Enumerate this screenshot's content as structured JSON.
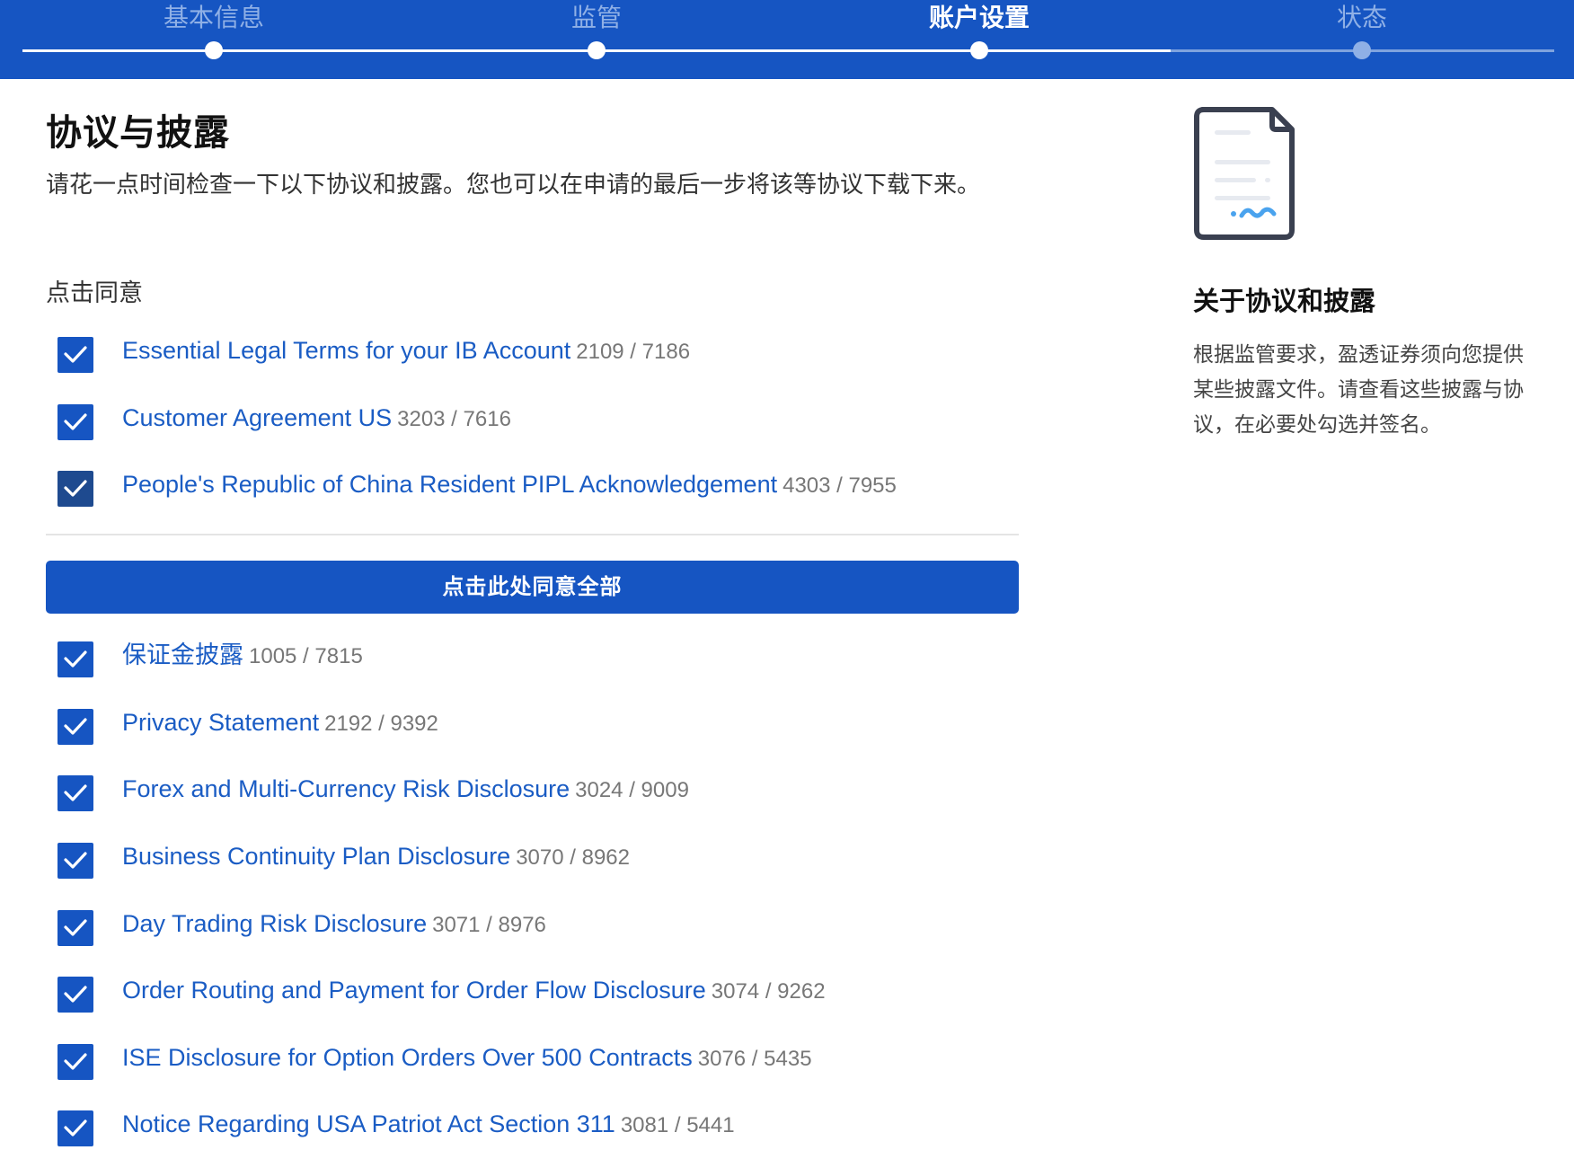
{
  "stepper": {
    "steps": [
      {
        "label": "基本信息",
        "state": "done"
      },
      {
        "label": "监管",
        "state": "done"
      },
      {
        "label": "账户设置",
        "state": "active"
      },
      {
        "label": "状态",
        "state": "todo"
      }
    ]
  },
  "main": {
    "title": "协议与披露",
    "intro": "请花一点时间检查一下以下协议和披露。您也可以在申请的最后一步将该等协议下载下来。",
    "click_to_agree_label": "点击同意",
    "group1": [
      {
        "title": "Essential Legal Terms for your IB Account",
        "number": "2109 / 7186",
        "checked": true
      },
      {
        "title": "Customer Agreement US",
        "number": "3203 / 7616",
        "checked": true
      },
      {
        "title": "People's Republic of China Resident PIPL Acknowledgement",
        "number": "4303 / 7955",
        "checked": true
      }
    ],
    "agree_all_label": "点击此处同意全部",
    "group2": [
      {
        "title": "保证金披露",
        "number": "1005 / 7815",
        "checked": true
      },
      {
        "title": "Privacy Statement",
        "number": "2192 / 9392",
        "checked": true
      },
      {
        "title": "Forex and Multi-Currency Risk Disclosure",
        "number": "3024 / 9009",
        "checked": true
      },
      {
        "title": "Business Continuity Plan Disclosure",
        "number": "3070 / 8962",
        "checked": true
      },
      {
        "title": "Day Trading Risk Disclosure",
        "number": "3071 / 8976",
        "checked": true
      },
      {
        "title": "Order Routing and Payment for Order Flow Disclosure",
        "number": "3074 / 9262",
        "checked": true
      },
      {
        "title": "ISE Disclosure for Option Orders Over 500 Contracts",
        "number": "3076 / 5435",
        "checked": true
      },
      {
        "title": "Notice Regarding USA Patriot Act Section 311",
        "number": "3081 / 5441",
        "checked": true
      }
    ]
  },
  "side": {
    "icon": "document-signature-icon",
    "title": "关于协议和披露",
    "body": "根据监管要求，盈透证券须向您提供某些披露文件。请查看这些披露与协议，在必要处勾选并签名。"
  },
  "colors": {
    "header_bg": "#1655c2",
    "link": "#1a5cc4",
    "checkbox": "#1655c2",
    "button": "#1655c2"
  }
}
